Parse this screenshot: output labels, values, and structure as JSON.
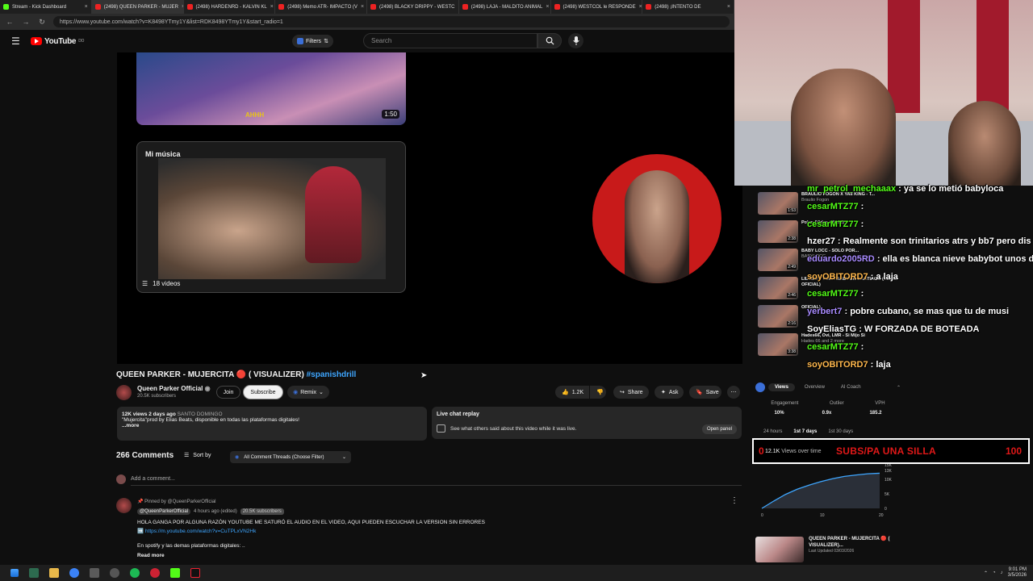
{
  "tabs": [
    {
      "label": "Stream - Kick Dashboard",
      "active": false
    },
    {
      "label": "(2498) QUEEN PARKER - MUJER",
      "active": true
    },
    {
      "label": "(2498) HARDENRD - KALVIN KL",
      "active": false
    },
    {
      "label": "(2498) Memo ATR- IMPACTO (V",
      "active": false
    },
    {
      "label": "(2498) BLACKY DRIPPY - WESTC",
      "active": false
    },
    {
      "label": "(2498) LAJA - MALDITO ANIMAL",
      "active": false
    },
    {
      "label": "(2498) WESTCOL le RESPONDE",
      "active": false
    },
    {
      "label": "(2498) ¡INTENTO DE",
      "active": false
    }
  ],
  "address": {
    "url": "https://www.youtube.com/watch?v=K8498YTmy1Y&list=RDK8498YTmy1Y&start_radio=1"
  },
  "header": {
    "logo": "YouTube",
    "logo_sup": "DO",
    "filters_label": "Filters",
    "search_placeholder": "Search"
  },
  "player": {
    "thumb_caption": "AHHH",
    "thumb_duration": "1:50",
    "mix_title": "Mi música",
    "mix_count": "18 videos"
  },
  "video": {
    "title": "QUEEN PARKER - MUJERCITA 🔴 ( VISUALIZER)",
    "hashtag": "#spanishdrill",
    "channel": "Queen Parker Official",
    "subscribers": "20.5K subscribers",
    "join": "Join",
    "subscribe": "Subscribe",
    "remix": "Remix",
    "likes": "1.2K",
    "share": "Share",
    "ask": "Ask",
    "save": "Save"
  },
  "description": {
    "meta": "12K views  2 days ago",
    "location": "SANTO DOMINGO",
    "text": "\"Mujercita\"prod by Elias Beats, disponible en todas las plataformas digitales!",
    "more": "...more"
  },
  "live_chat": {
    "title": "Live chat replay",
    "text": "See what others said about this video while it was live.",
    "button": "Open panel"
  },
  "comments": {
    "count": "266 Comments",
    "sort_label": "Sort by",
    "filter": "All Comment Threads (Choose Filter)",
    "add_placeholder": "Add a comment...",
    "pinned": "Pinned by @QueenParkerOfficial",
    "author": "@QueenParkerOfficial",
    "time": "4 hours ago (edited)",
    "author_subs": "20.5K subscribers",
    "text": "HOLA GANGA POR ALGUNA RAZÓN YOUTUBE ME SATURÓ EL AUDIO EN EL VIDEO, AQUI PUEDEN ESCUCHAR LA VERSION SIN ERRORES",
    "link": "➡️ https://m.youtube.com/watch?v=CuTPLxVN2Hk",
    "text2": "En spotify y las demas plataformas digitales: ..",
    "read_more": "Read more"
  },
  "side_videos": [
    {
      "title": "BRAULIO FOGON X YAII KING - T...",
      "channel": "Braulio Fogon",
      "duration": "1:53"
    },
    {
      "title": "Polvo (Video Oficial)",
      "channel": "",
      "duration": "2:38"
    },
    {
      "title": "BABY LOCC - SOLO POR...",
      "channel": "BABYLOCC",
      "duration": "2:49"
    },
    {
      "title": "LIL NAKY - UNA BABY EN SANTIAGO (VIDEO OFICIAL)",
      "channel": "",
      "duration": "2:46"
    },
    {
      "title": "OFICIAL)",
      "channel": "",
      "duration": "2:16"
    },
    {
      "title": "Hades66, Ovi, LMR - Si Mijo Si",
      "channel": "Hades 66 and 2 more",
      "duration": "3:38"
    }
  ],
  "chat": [
    {
      "user": "mr_petrol_mechaaax",
      "msg": ": ya se lo metió babyloca",
      "color": "green"
    },
    {
      "user": "cesarMTZ77",
      "msg": ":",
      "color": "green"
    },
    {
      "user": "cesarMTZ77",
      "msg": ":",
      "color": "green"
    },
    {
      "user": "hzer27",
      "msg": ": Realmente son trinitarios atrs y bb7 pero dis",
      "color": "white"
    },
    {
      "user": "eduardo2005RD",
      "msg": ": ella es blanca nieve babybot unos d",
      "color": "purple"
    },
    {
      "user": "soyOBITORD7",
      "msg": ": a laja",
      "color": "orange"
    },
    {
      "user": "cesarMTZ77",
      "msg": ":",
      "color": "green"
    },
    {
      "user": "yerbert7",
      "msg": ": pobre cubano, se mas que tu de musi",
      "color": "purple"
    },
    {
      "user": "SoyEliasTG",
      "msg": ": W FORZADA DE BOTEADA",
      "color": "white"
    },
    {
      "user": "cesarMTZ77",
      "msg": ":",
      "color": "green"
    },
    {
      "user": "soyOBITORD7",
      "msg": ": laja",
      "color": "orange"
    }
  ],
  "analytics": {
    "tabs": [
      "Views",
      "Overview",
      "AI Coach"
    ],
    "stat_labels": [
      "Engagement",
      "Outlier",
      "VPH"
    ],
    "stat_values": [
      "10%",
      "0.9x",
      "185.2"
    ],
    "ranges": [
      "24 hours",
      "1st 7 days",
      "1st 30 days"
    ],
    "views_label": "Views over time",
    "views_total": "12.1K",
    "video_title": "QUEEN PARKER - MUJERCITA 🔴 ( VISUALIZER)...",
    "video_date": "Last Updated 03/03/2026"
  },
  "chart_data": {
    "type": "line",
    "x": [
      0,
      2,
      4,
      6,
      8,
      10,
      12,
      14,
      16,
      18,
      20
    ],
    "y": [
      0,
      2500,
      4800,
      6600,
      8000,
      9200,
      10200,
      11000,
      11500,
      11900,
      12100
    ],
    "xticks": [
      "0",
      "10",
      "20"
    ],
    "yticks": [
      "0",
      "5K",
      "10K",
      "13K",
      "15K"
    ],
    "ylim": [
      0,
      15000
    ],
    "xlim": [
      0,
      20
    ],
    "color": "#3ea6ff"
  },
  "goal": {
    "current": "0",
    "label": "SUBS/PA UNA SILLA",
    "target": "100"
  },
  "taskbar": {
    "time": "9:01 PM",
    "date": "3/5/2026"
  },
  "colors": {
    "accent": "#3ea6ff",
    "youtube_red": "#ff0000",
    "kick_green": "#53fc18",
    "goal_red": "#e01818"
  }
}
